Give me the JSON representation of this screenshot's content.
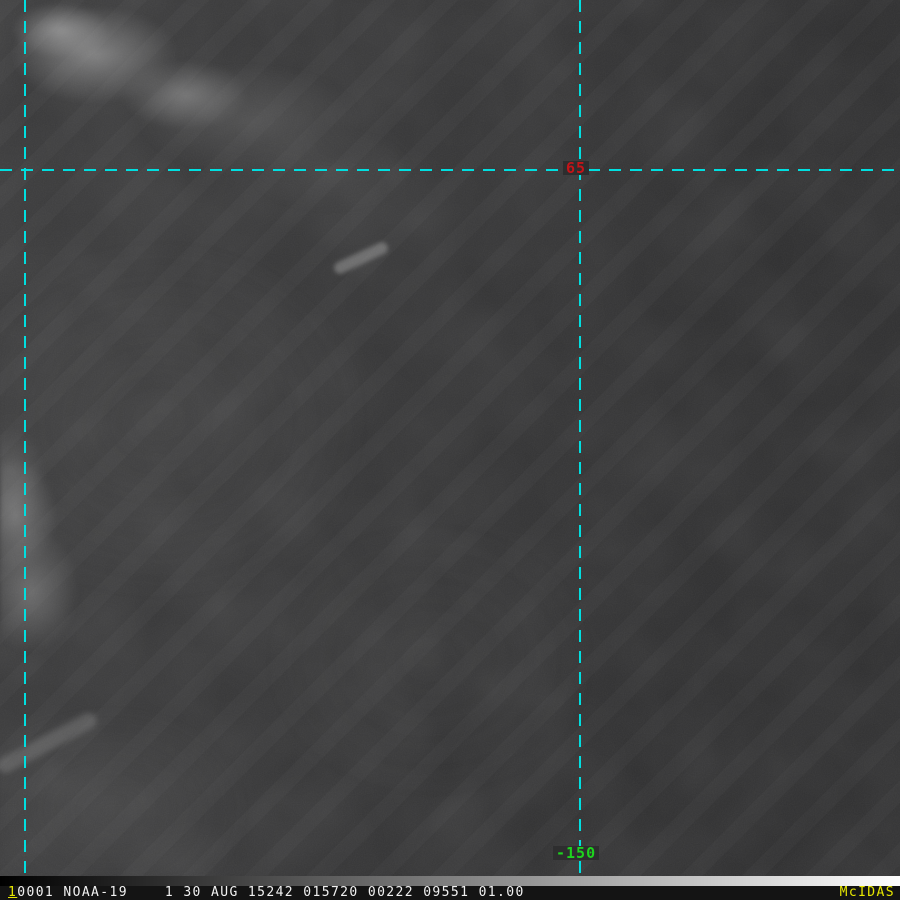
{
  "map_labels": {
    "latitude_label": "65",
    "longitude_label": "-150"
  },
  "status_bar": {
    "frame_number": "1",
    "image_info": "0001 NOAA-19    1 30 AUG 15242 015720 00222 09551 01.00",
    "brand": "McIDAS"
  },
  "colors": {
    "gridline": "#00dfe0",
    "latitude_label": "#c41418",
    "longitude_label": "#1ed31e",
    "status_text": "#f2f2f2",
    "frame_number": "#e8e800",
    "brand": "#e8e800",
    "image_base": "#2f2f30",
    "status_background": "#141414"
  },
  "scale_bar": {
    "left_end": "black",
    "right_end": "white"
  }
}
